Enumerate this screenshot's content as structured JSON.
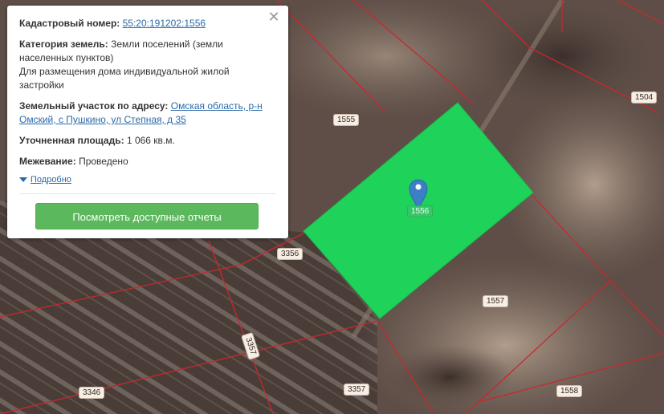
{
  "popup": {
    "cadastral_number_label": "Кадастровый номер:",
    "cadastral_number_value": "55:20:191202:1556",
    "land_category_label": "Категория земель:",
    "land_category_value": "Земли поселений (земли населенных пунктов)",
    "permitted_use": "Для размещения дома индивидуальной жилой застройки",
    "address_label": "Земельный участок по адресу:",
    "address_value": "Омская область, р-н Омский, с Пушкино, ул Степная, д 35",
    "area_label": "Уточненная площадь:",
    "area_value": "1 066 кв.м.",
    "survey_label": "Межевание:",
    "survey_value": "Проведено",
    "details_link": "Подробно",
    "reports_button": "Посмотреть доступные отчеты",
    "close_icon": "close-icon"
  },
  "map": {
    "parcel_labels": [
      "1555",
      "1504",
      "3356",
      "1557",
      "3357",
      "3357",
      "3346",
      "1558",
      "1556"
    ],
    "selected_parcel_color": "#1fd35a",
    "boundary_color": "#c8282d",
    "marker_color": "#3b7fc4",
    "marker_icon": "map-pin-icon"
  }
}
